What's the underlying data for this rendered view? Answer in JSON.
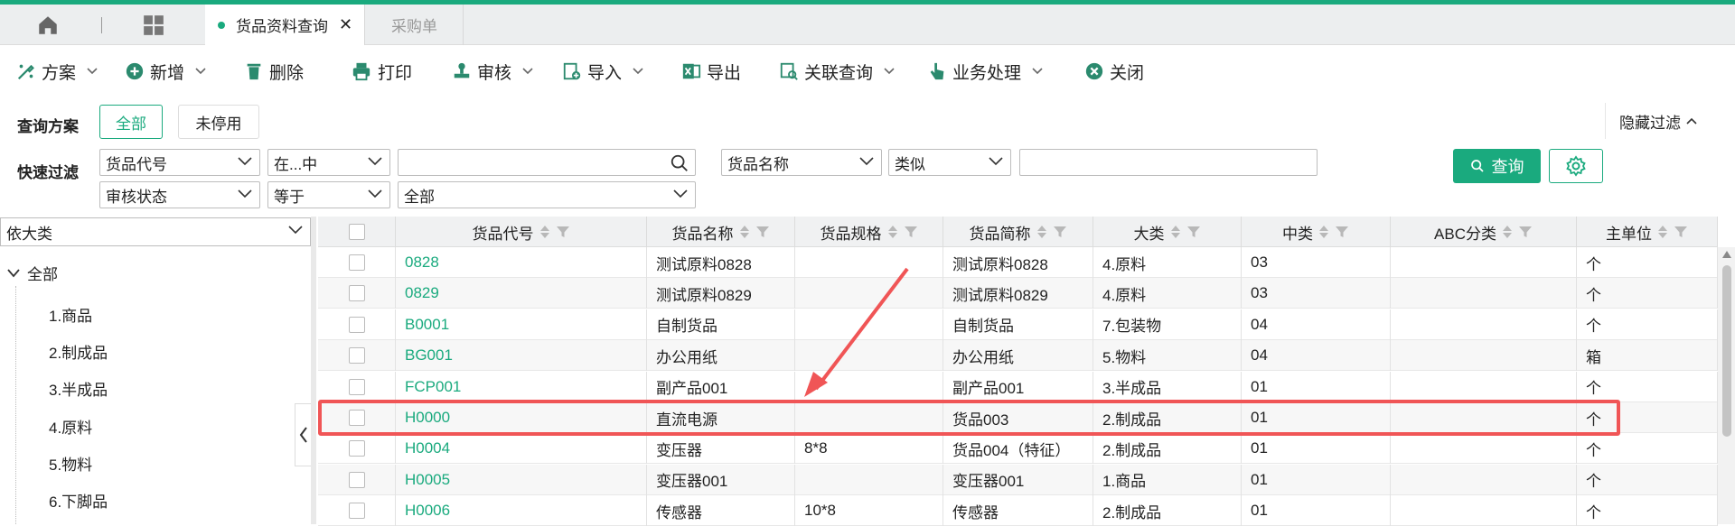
{
  "tabs": [
    {
      "label": "货品资料查询",
      "active": true
    },
    {
      "label": "采购单",
      "active": false
    }
  ],
  "toolbar": [
    {
      "label": "方案",
      "icon": "scheme-icon",
      "dropdown": true
    },
    {
      "label": "新增",
      "icon": "plus-circle-icon",
      "dropdown": true
    },
    {
      "label": "删除",
      "icon": "trash-icon",
      "dropdown": false
    },
    {
      "label": "打印",
      "icon": "printer-icon",
      "dropdown": false
    },
    {
      "label": "审核",
      "icon": "stamp-icon",
      "dropdown": true
    },
    {
      "label": "导入",
      "icon": "import-icon",
      "dropdown": true
    },
    {
      "label": "导出",
      "icon": "excel-icon",
      "dropdown": false
    },
    {
      "label": "关联查询",
      "icon": "link-search-icon",
      "dropdown": true
    },
    {
      "label": "业务处理",
      "icon": "hand-pointer-icon",
      "dropdown": true
    },
    {
      "label": "关闭",
      "icon": "close-circle-icon",
      "dropdown": false
    }
  ],
  "query": {
    "scheme_label": "查询方案",
    "scheme_all": "全部",
    "scheme_not_disabled": "未停用",
    "quick_filter_label": "快速过滤",
    "hide_filter": "隐藏过滤",
    "field1": "货品代号",
    "op1": "在...中",
    "value1": "",
    "field2": "货品名称",
    "op2": "类似",
    "value2": "",
    "field3": "审核状态",
    "op3": "等于",
    "value3": "全部",
    "query_button": "查询"
  },
  "tree": {
    "group_by": "依大类",
    "root": "全部",
    "items": [
      "1.商品",
      "2.制成品",
      "3.半成品",
      "4.原料",
      "5.物料",
      "6.下脚品"
    ]
  },
  "grid": {
    "columns": [
      "货品代号",
      "货品名称",
      "货品规格",
      "货品简称",
      "大类",
      "中类",
      "ABC分类",
      "主单位"
    ],
    "rows": [
      [
        "0828",
        "测试原料0828",
        "",
        "测试原料0828",
        "4.原料",
        "03",
        "",
        "个"
      ],
      [
        "0829",
        "测试原料0829",
        "",
        "测试原料0829",
        "4.原料",
        "03",
        "",
        "个"
      ],
      [
        "B0001",
        "自制货品",
        "",
        "自制货品",
        "7.包装物",
        "04",
        "",
        "个"
      ],
      [
        "BG001",
        "办公用纸",
        "",
        "办公用纸",
        "5.物料",
        "04",
        "",
        "箱"
      ],
      [
        "FCP001",
        "副产品001",
        "",
        "副产品001",
        "3.半成品",
        "01",
        "",
        "个"
      ],
      [
        "H0000",
        "直流电源",
        "",
        "货品003",
        "2.制成品",
        "01",
        "",
        "个"
      ],
      [
        "H0004",
        "变压器",
        "8*8",
        "货品004（特征）",
        "2.制成品",
        "01",
        "",
        "个"
      ],
      [
        "H0005",
        "变压器001",
        "",
        "变压器001",
        "1.商品",
        "01",
        "",
        "个"
      ],
      [
        "H0006",
        "传感器",
        "10*8",
        "传感器",
        "2.制成品",
        "01",
        "",
        "个"
      ]
    ],
    "highlighted_row": 5
  },
  "colors": {
    "accent": "#1aaa7e",
    "highlight": "#f05556"
  }
}
